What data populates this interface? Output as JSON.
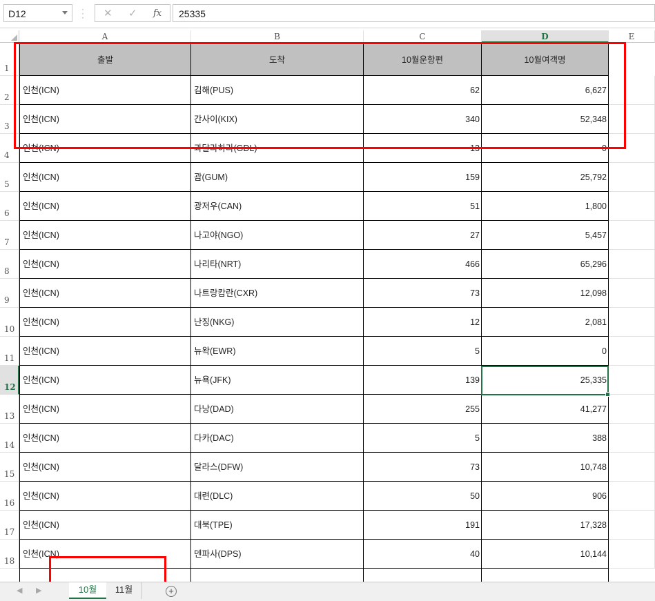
{
  "formula_bar": {
    "name_box": "D12",
    "formula_value": "25335",
    "cancel_icon": "✕",
    "enter_icon": "✓",
    "fx_label": "fx"
  },
  "columns": [
    "A",
    "B",
    "C",
    "D",
    "E"
  ],
  "active_column": "D",
  "active_row": "12",
  "table": {
    "headers": [
      "출발",
      "도착",
      "10월운항편",
      "10월여객명"
    ],
    "rows": [
      [
        "인천(ICN)",
        "김해(PUS)",
        "62",
        "6,627"
      ],
      [
        "인천(ICN)",
        "간사이(KIX)",
        "340",
        "52,348"
      ],
      [
        "인천(ICN)",
        "과달라하라(GDL)",
        "13",
        "0"
      ],
      [
        "인천(ICN)",
        "괌(GUM)",
        "159",
        "25,792"
      ],
      [
        "인천(ICN)",
        "광저우(CAN)",
        "51",
        "1,800"
      ],
      [
        "인천(ICN)",
        "나고야(NGO)",
        "27",
        "5,457"
      ],
      [
        "인천(ICN)",
        "나리타(NRT)",
        "466",
        "65,296"
      ],
      [
        "인천(ICN)",
        "나트랑캄란(CXR)",
        "73",
        "12,098"
      ],
      [
        "인천(ICN)",
        "난징(NKG)",
        "12",
        "2,081"
      ],
      [
        "인천(ICN)",
        "뉴왁(EWR)",
        "5",
        "0"
      ],
      [
        "인천(ICN)",
        "뉴욕(JFK)",
        "139",
        "25,335"
      ],
      [
        "인천(ICN)",
        "다낭(DAD)",
        "255",
        "41,277"
      ],
      [
        "인천(ICN)",
        "다카(DAC)",
        "5",
        "388"
      ],
      [
        "인천(ICN)",
        "달라스(DFW)",
        "73",
        "10,748"
      ],
      [
        "인천(ICN)",
        "대련(DLC)",
        "50",
        "906"
      ],
      [
        "인천(ICN)",
        "대북(TPE)",
        "191",
        "17,328"
      ],
      [
        "인천(ICN)",
        "덴파사(DPS)",
        "40",
        "10,144"
      ]
    ]
  },
  "row_numbers": [
    "1",
    "2",
    "3",
    "4",
    "5",
    "6",
    "7",
    "8",
    "9",
    "10",
    "11",
    "12",
    "13",
    "14",
    "15",
    "16",
    "17",
    "18"
  ],
  "sheet_tabs": [
    "10월",
    "11월"
  ],
  "active_sheet": "10월",
  "colors": {
    "accent": "#217346",
    "annotation": "#ff0000",
    "header_fill": "#c0c0c0"
  },
  "icons": [
    "chevron-down-icon",
    "cancel-icon",
    "enter-icon",
    "function-icon",
    "nav-left-icon",
    "nav-right-icon",
    "add-sheet-icon"
  ]
}
